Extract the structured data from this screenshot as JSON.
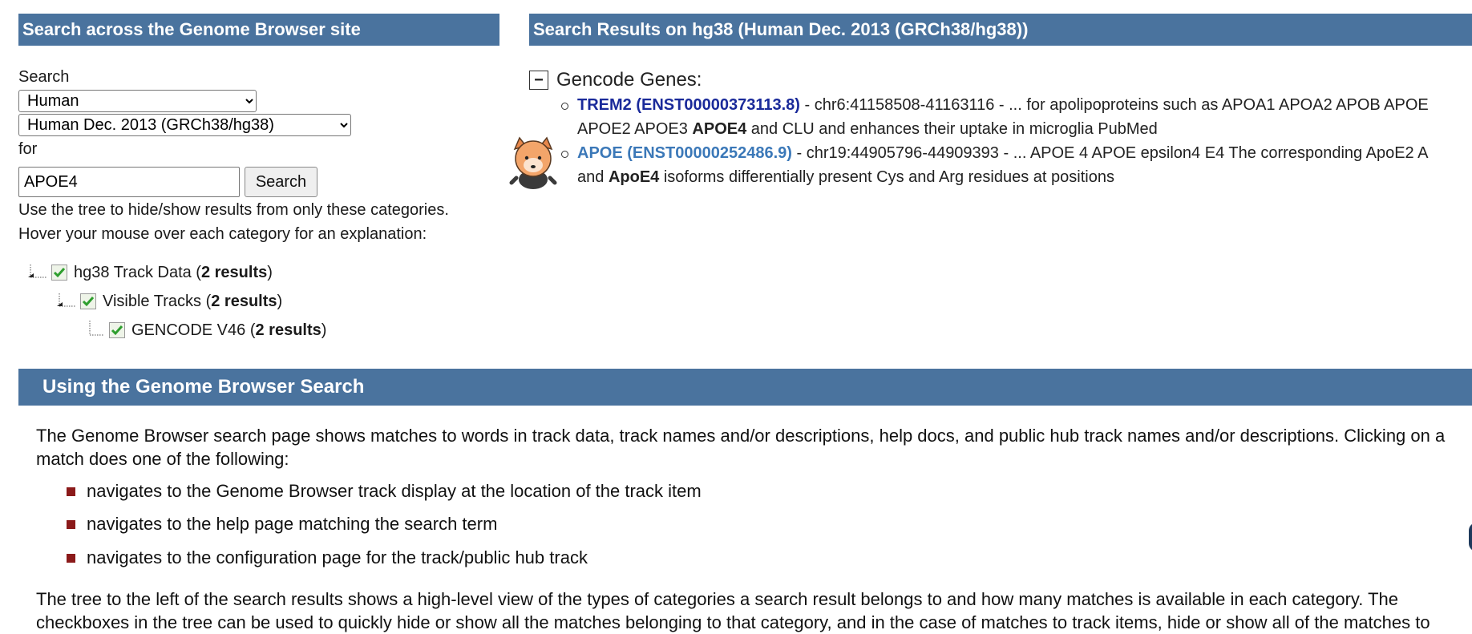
{
  "left_panel": {
    "title": "Search across the Genome Browser site",
    "search_label": "Search",
    "genome_select": {
      "selected": "Human",
      "options": [
        "Human"
      ]
    },
    "assembly_select": {
      "selected": "Human Dec. 2013 (GRCh38/hg38)",
      "options": [
        "Human Dec. 2013 (GRCh38/hg38)"
      ]
    },
    "for_label": "for",
    "search_value": "APOE4",
    "search_button": "Search",
    "hint_line1": "Use the tree to hide/show results from only these categories.",
    "hint_line2": "Hover your mouse over each category for an explanation:",
    "tree": [
      {
        "label": "hg38 Track Data (",
        "count": "2 results",
        "close": ")"
      },
      {
        "label": "Visible Tracks (",
        "count": "2 results",
        "close": ")"
      },
      {
        "label": "GENCODE V46 (",
        "count": "2 results",
        "close": ")"
      }
    ]
  },
  "results_panel": {
    "title": "Search Results on hg38 (Human Dec. 2013 (GRCh38/hg38))",
    "collapse_symbol": "−",
    "category": "Gencode Genes:",
    "results": [
      {
        "link": "TREM2 (ENST00000373113.8)",
        "line1_rest": " - chr6:41158508-41163116 - ... for apolipoproteins such as APOA1 APOA2 APOB APOE",
        "line2_pre": "APOE2 APOE3 ",
        "line2_bold": "APOE4",
        "line2_post": " and CLU and enhances their uptake in microglia PubMed"
      },
      {
        "link": "APOE (ENST00000252486.9)",
        "line1_rest": " - chr19:44905796-44909393 - ... APOE 4 APOE epsilon4 E4 The corresponding ApoE2 A",
        "line2_pre": "and ",
        "line2_bold": "ApoE4",
        "line2_post": " isoforms differentially present Cys and Arg residues at positions"
      }
    ]
  },
  "guide": {
    "title": "Using the Genome Browser Search",
    "intro_line1": "The Genome Browser search page shows matches to words in track data, track names and/or descriptions, help docs, and public hub track names and/or descriptions. Clicking on a",
    "intro_line2": "match does one of the following:",
    "bullets": [
      "navigates to the Genome Browser track display at the location of the track item",
      "navigates to the help page matching the search term",
      "navigates to the configuration page for the track/public hub track"
    ],
    "tree_line1": "The tree to the left of the search results shows a high-level view of the types of categories a search result belongs to and how many matches is available in each category. The",
    "tree_line2": "checkboxes in the tree can be used to quickly hide or show all the matches belonging to that category, and in the case of matches to track items, hide or show all of the matches to"
  },
  "colors": {
    "header_bg": "#4a739e",
    "bullet": "#8b1a1a",
    "link_primary": "#1a2a9a",
    "link_secondary": "#3b78b8"
  }
}
